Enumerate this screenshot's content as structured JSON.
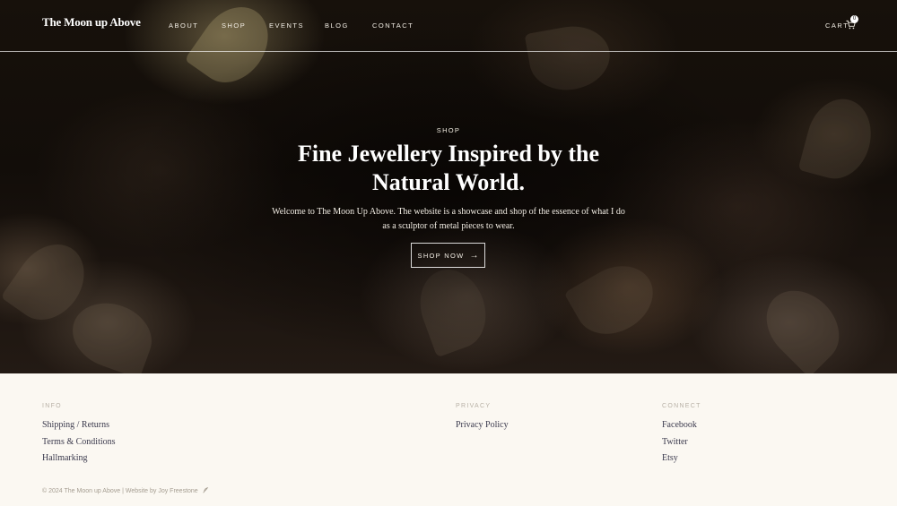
{
  "header": {
    "logo": "The Moon up Above",
    "nav": [
      {
        "label": "ABOUT"
      },
      {
        "label": "SHOP"
      },
      {
        "label": "EVENTS"
      },
      {
        "label": "BLOG"
      },
      {
        "label": "CONTACT"
      }
    ],
    "cart_label": "CART",
    "cart_count": "0",
    "cart_icon": "cart-icon"
  },
  "hero": {
    "eyebrow": "SHOP",
    "headline": "Fine Jewellery Inspired by the Natural World.",
    "intro": "Welcome to The Moon Up Above. The website is a showcase and shop of the essence of what I do as a sculptor of metal pieces to wear.",
    "cta_label": "SHOP NOW",
    "cta_icon": "arrow-right-icon"
  },
  "footer": {
    "info": {
      "heading": "INFO",
      "links": [
        "Shipping / Returns",
        "Terms & Conditions",
        "Hallmarking"
      ]
    },
    "privacy": {
      "heading": "PRIVACY",
      "links": [
        "Privacy Policy"
      ]
    },
    "connect": {
      "heading": "CONNECT",
      "links": [
        "Facebook",
        "Twitter",
        "Etsy"
      ]
    },
    "copyright": "© 2024 The Moon up Above",
    "separator": "|",
    "credit": "Website by Joy Freestone",
    "credit_icon": "feather-icon"
  },
  "colors": {
    "hero_bg": "#120d09",
    "footer_bg": "#fbf8f2",
    "link": "#3b3a4d",
    "muted": "#b8b1a6"
  }
}
